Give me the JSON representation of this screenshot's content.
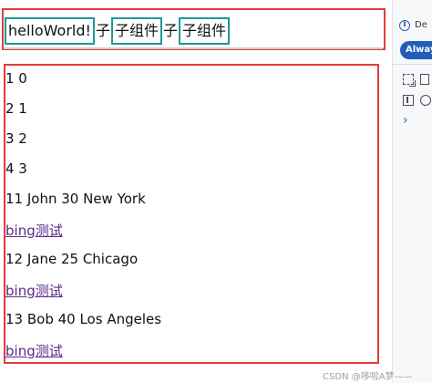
{
  "top": {
    "hello": "helloWorld!",
    "child1": "子组件",
    "child2": "子组件",
    "sep": "子"
  },
  "rows": [
    {
      "text": "1 0",
      "type": "text"
    },
    {
      "text": "2 1",
      "type": "text"
    },
    {
      "text": "3 2",
      "type": "text"
    },
    {
      "text": "4 3",
      "type": "text"
    },
    {
      "text": "11 John 30 New York",
      "type": "text"
    },
    {
      "text": "bing测试",
      "type": "link"
    },
    {
      "text": "12 Jane 25 Chicago",
      "type": "text"
    },
    {
      "text": "bing测试",
      "type": "link"
    },
    {
      "text": "13 Bob 40 Los Angeles",
      "type": "text"
    },
    {
      "text": "bing测试",
      "type": "link"
    }
  ],
  "devtools": {
    "de_label": "De",
    "always_label": "Alway",
    "chevron": "›"
  },
  "watermark": "CSDN @哆啦A梦——",
  "colors": {
    "highlight_red": "#e63b3b",
    "highlight_teal": "#1a9a9a",
    "link": "#5a2a86",
    "accent_blue": "#1f5fb8"
  }
}
